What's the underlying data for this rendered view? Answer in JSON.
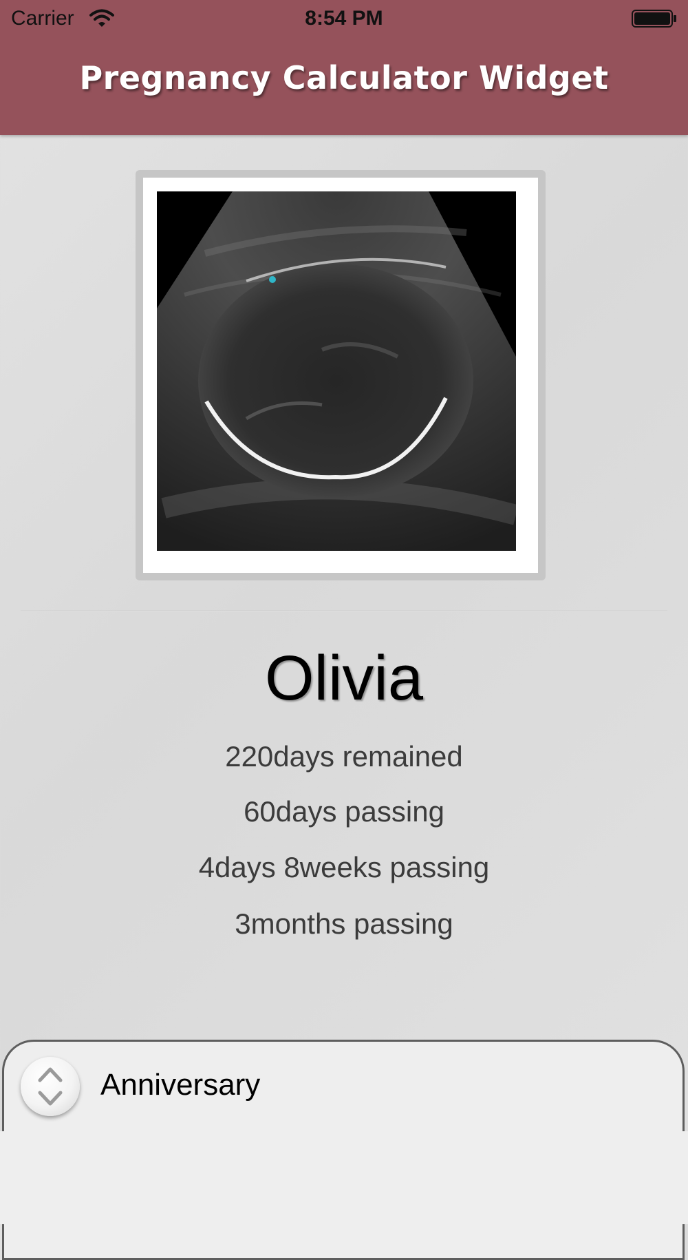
{
  "status_bar": {
    "carrier": "Carrier",
    "time": "8:54 PM",
    "wifi_icon": "wifi-icon",
    "battery_icon": "battery-icon"
  },
  "header": {
    "title": "Pregnancy Calculator Widget",
    "color": "#95525b"
  },
  "photo": {
    "description_icon": "ultrasound-image"
  },
  "baby": {
    "name": "Olivia",
    "stats": [
      "220days remained",
      "60days passing",
      "4days 8weeks passing",
      "3months passing"
    ]
  },
  "panel": {
    "label": "Anniversary",
    "toggle_icon": "chevron-up-down-icon"
  }
}
